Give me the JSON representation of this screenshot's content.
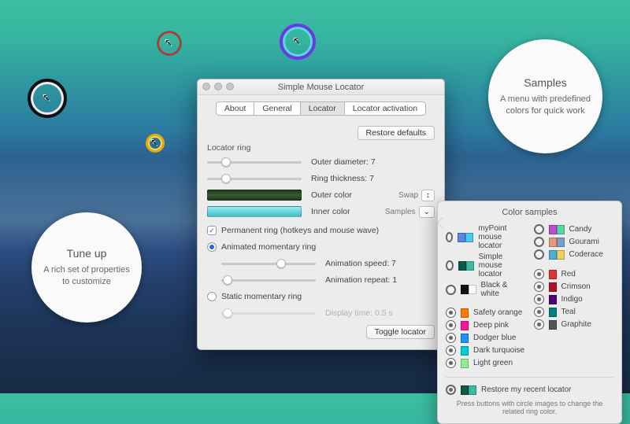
{
  "callouts": {
    "tuneup": {
      "title": "Tune up",
      "text": "A rich set of properties to customize"
    },
    "samples": {
      "title": "Samples",
      "text": "A menu with predefined colors for quick work"
    }
  },
  "window": {
    "title": "Simple Mouse Locator",
    "tabs": {
      "about": "About",
      "general": "General",
      "locator": "Locator",
      "activation": "Locator activation"
    },
    "restore_defaults": "Restore defaults",
    "section_ring": "Locator ring",
    "outer_diameter_label": "Outer diameter: 7",
    "ring_thickness_label": "Ring thickness: 7",
    "outer_color_label": "Outer color",
    "inner_color_label": "Inner color",
    "swap_label": "Swap",
    "samples_label": "Samples",
    "perm_label": "Permanent ring (hotkeys and mouse wave)",
    "anim_label": "Animated momentary ring",
    "anim_speed_label": "Animation speed: 7",
    "anim_repeat_label": "Animation repeat: 1",
    "static_label": "Static momentary ring",
    "display_time_label": "Display time: 0.5 s",
    "toggle_label": "Toggle locator",
    "outer_diameter_value": 7,
    "ring_thickness_value": 7,
    "anim_speed_value": 7,
    "anim_repeat_value": 1,
    "colors": {
      "outer": "#1d3d1a",
      "inner": "#5fd5e0"
    }
  },
  "popover": {
    "title": "Color samples",
    "restore_label": "Restore my recent locator",
    "restore_colors": [
      "#0a5a4e",
      "#3fb9a0"
    ],
    "hint": "Press buttons with circle images to change the related ring color.",
    "col1": [
      {
        "label": "myPoint mouse locator",
        "c1": "#5b86e5",
        "c2": "#47c9f3",
        "style": "bold"
      },
      {
        "label": "Simple mouse locator",
        "c1": "#0a5a4e",
        "c2": "#3fb9a0",
        "style": "bold"
      },
      {
        "label": "Black & white",
        "c1": "#111111",
        "c2": "#ffffff",
        "style": "bold"
      },
      {
        "label": "Safety orange",
        "c1": "#ff7a00",
        "style": "dot"
      },
      {
        "label": "Deep pink",
        "c1": "#ff1493",
        "style": "dot"
      },
      {
        "label": "Dodger blue",
        "c1": "#1e90ff",
        "style": "dot"
      },
      {
        "label": "Dark turquoise",
        "c1": "#00ced1",
        "style": "dot"
      },
      {
        "label": "Light green",
        "c1": "#90ee90",
        "style": "dot"
      }
    ],
    "col2": [
      {
        "label": "Candy",
        "c1": "#b84fd6",
        "c2": "#5bd6a3",
        "style": "bold"
      },
      {
        "label": "Gourami",
        "c1": "#e69a7a",
        "c2": "#76a0c6",
        "style": "bold"
      },
      {
        "label": "Coderace",
        "c1": "#4bb0d8",
        "c2": "#f0cf5b",
        "style": "bold"
      },
      {
        "label": "Red",
        "c1": "#e03030",
        "style": "dot"
      },
      {
        "label": "Crimson",
        "c1": "#b01030",
        "style": "dot"
      },
      {
        "label": "Indigo",
        "c1": "#4b0082",
        "style": "dot"
      },
      {
        "label": "Teal",
        "c1": "#008080",
        "style": "dot"
      },
      {
        "label": "Graphite",
        "c1": "#555555",
        "style": "dot"
      }
    ]
  }
}
